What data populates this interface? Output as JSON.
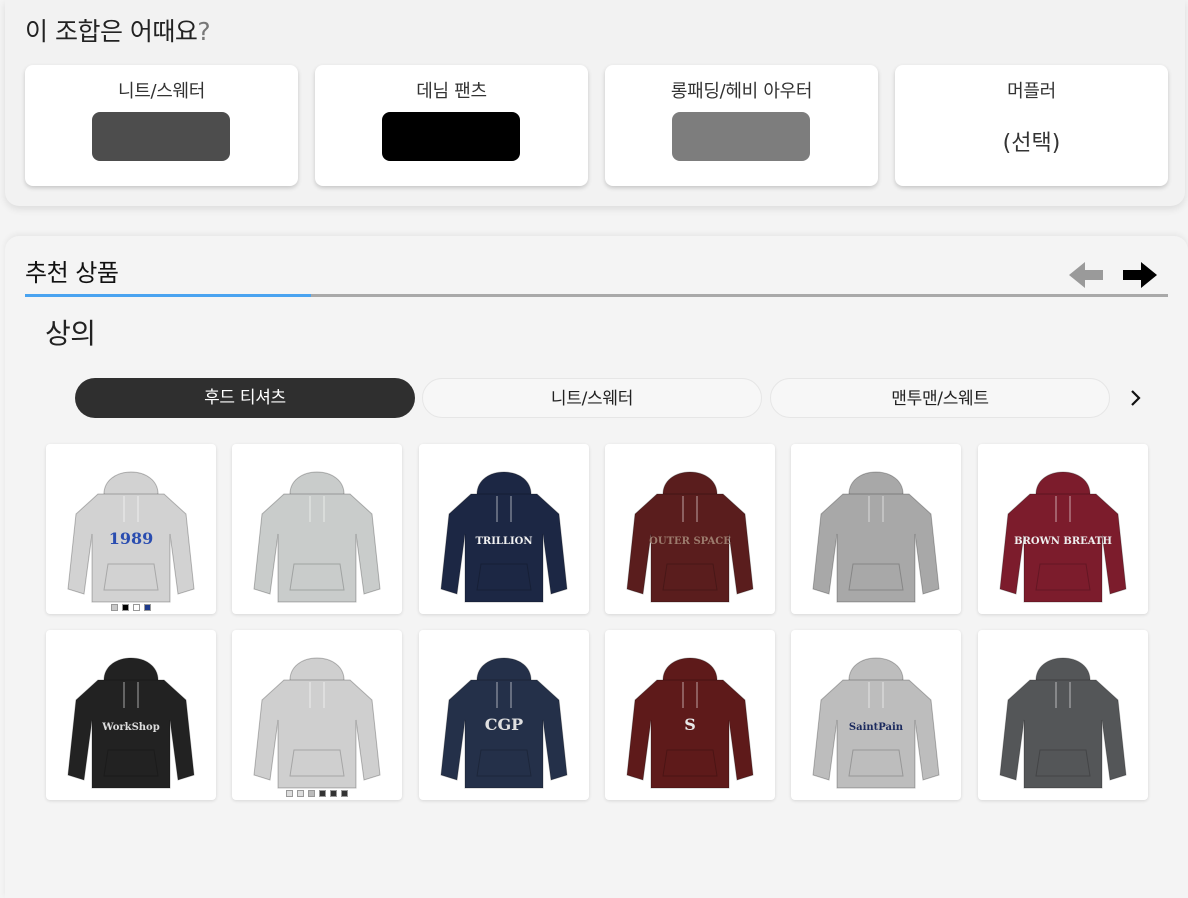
{
  "combo": {
    "title": "이 조합은 어때요",
    "title_mark": "?",
    "items": [
      {
        "label": "니트/스웨터",
        "color": "#4d4d4d"
      },
      {
        "label": "데님 팬츠",
        "color": "#000000"
      },
      {
        "label": "롱패딩/헤비 아우터",
        "color": "#7d7d7d"
      },
      {
        "label": "머플러",
        "optional_text": "(선택)"
      }
    ]
  },
  "recommend": {
    "title": "추천 상품",
    "category_title": "상의",
    "tabs": [
      {
        "label": "후드 티셔츠",
        "active": true
      },
      {
        "label": "니트/스웨터",
        "active": false
      },
      {
        "label": "맨투맨/스웨트",
        "active": false
      }
    ],
    "arrows": {
      "prev_color": "#9a9a9a",
      "next_color": "#000000"
    },
    "accent_color": "#4aa3f0",
    "products": [
      {
        "name": "1989 graphic hoodie",
        "body": "#d2d2d2",
        "print_text": "1989",
        "print_color": "#2a4db0",
        "swatches": [
          "#c8c8c8",
          "#000000",
          "#ffffff",
          "#1e3a8a"
        ]
      },
      {
        "name": "model grey hoodie with cap",
        "body": "#c9cccb",
        "print_text": ""
      },
      {
        "name": "trillion studio navy hoodie",
        "body": "#1c2744",
        "print_text": "TRILLION",
        "print_color": "#f2f2f2"
      },
      {
        "name": "outer space burgundy hoodie",
        "body": "#5a1d1d",
        "print_text": "OUTER SPACE",
        "print_color": "#9c7b6d"
      },
      {
        "name": "model grey pocket hoodie",
        "body": "#a8a8a8",
        "print_text": ""
      },
      {
        "name": "brown breath burgundy hoodie",
        "body": "#7c1c2c",
        "print_text": "BROWN BREATH",
        "print_color": "#eeeeee"
      },
      {
        "name": "workshop black hoodie",
        "body": "#222222",
        "print_text": "WorkShop",
        "print_color": "#dddddd"
      },
      {
        "name": "star graphic hoodie set",
        "body": "#cfcfcf",
        "print_text": "",
        "swatches": [
          "#dddddd",
          "#dddddd",
          "#bbbbbb",
          "#333333",
          "#333333",
          "#333333"
        ]
      },
      {
        "name": "model navy hoodie set",
        "body": "#243049",
        "print_text": "CGP",
        "print_color": "#e0e0e0"
      },
      {
        "name": "S logo burgundy hoodie",
        "body": "#5e1a1a",
        "print_text": "S",
        "print_color": "#e8e8e8"
      },
      {
        "name": "saint pain grey hoodie",
        "body": "#bdbdbd",
        "print_text": "SaintPain",
        "print_color": "#1b2a5e"
      },
      {
        "name": "charcoal washed hoodie",
        "body": "#545658",
        "print_text": "",
        "print_color": "#3a3c3e"
      }
    ]
  }
}
